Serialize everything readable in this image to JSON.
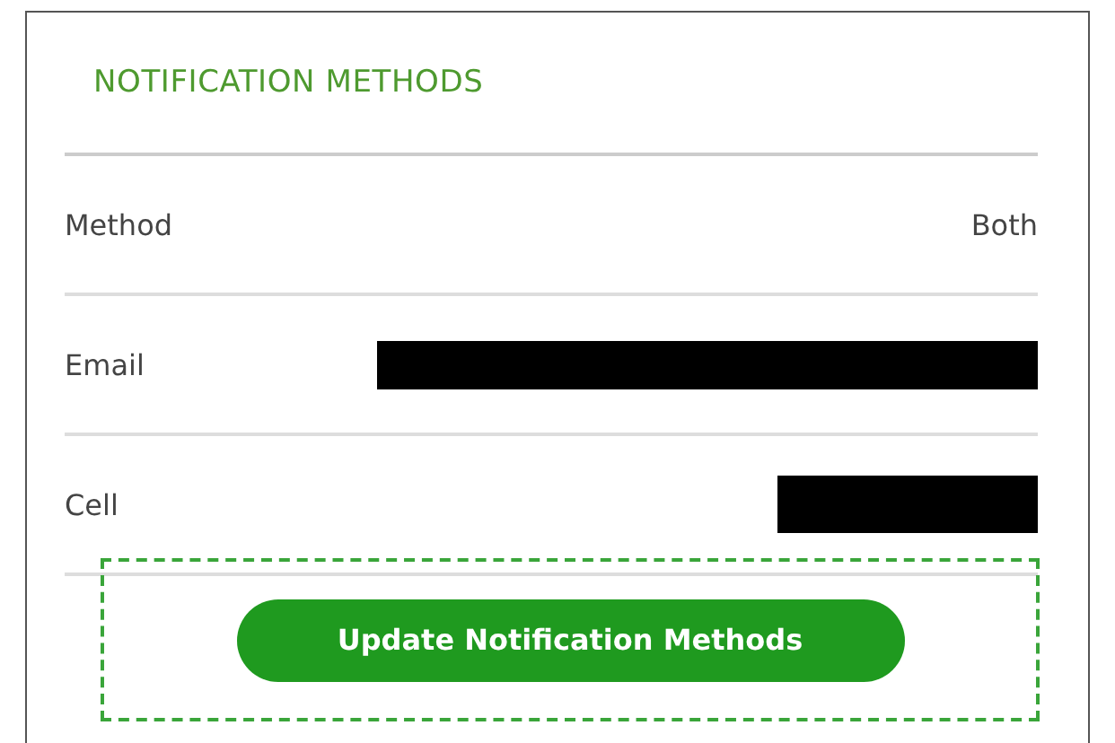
{
  "title": "NOTIFICATION METHODS",
  "rows": [
    {
      "label": "Method",
      "value": "Both",
      "redacted": false
    },
    {
      "label": "Email",
      "redacted": true,
      "kind": "long"
    },
    {
      "label": "Cell",
      "redacted": true,
      "kind": "short"
    }
  ],
  "button": {
    "label": "Update Notification Methods",
    "highlighted": true
  }
}
